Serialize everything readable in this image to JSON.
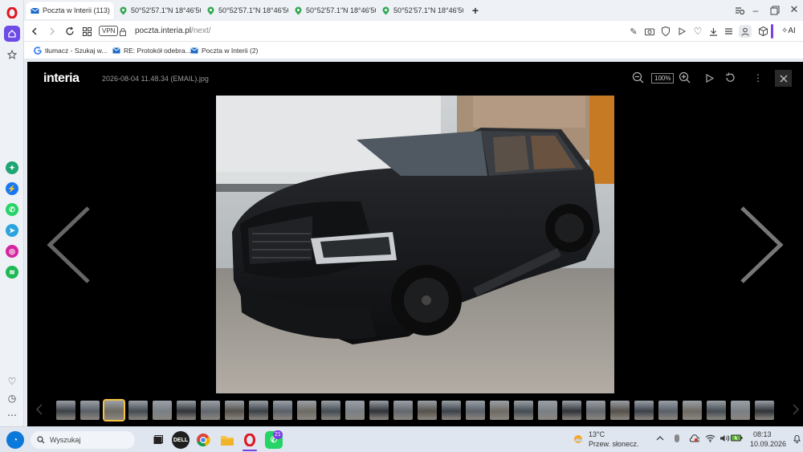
{
  "browser": {
    "tabs": [
      {
        "title": "Poczta w Interii (113)",
        "active": true,
        "icon": "mail-icon"
      },
      {
        "title": "50°52'57.1\"N 18°46'56.7\"E",
        "active": false,
        "icon": "maps-pin-icon"
      },
      {
        "title": "50°52'57.1\"N 18°46'56.7\"E",
        "active": false,
        "icon": "maps-pin-icon"
      },
      {
        "title": "50°52'57.1\"N 18°46'56.7\"E",
        "active": false,
        "icon": "maps-pin-icon"
      },
      {
        "title": "50°52'57.1\"N 18°46'56.7\"E",
        "active": false,
        "icon": "maps-pin-icon"
      }
    ],
    "new_tab_label": "+",
    "vpn_label": "VPN",
    "url_domain": "poczta.interia.pl",
    "url_path": "/next/",
    "ai_label": "AI",
    "bookmarks": [
      {
        "label": "tłumacz - Szukaj w...",
        "icon": "google-icon"
      },
      {
        "label": "RE: Protokół odebra...",
        "icon": "mail-icon"
      },
      {
        "label": "Poczta w Interii (2)",
        "icon": "mail-icon"
      }
    ]
  },
  "viewer": {
    "logo": "interia",
    "filename": "2026-08-04 11.48.34 (EMAIL).jpg",
    "zoom": "100%",
    "thumbnail_count": 30,
    "selected_thumbnail": 2
  },
  "taskbar": {
    "search_text": "Wyszukaj",
    "whatsapp_badge": "21",
    "weather_temp": "13°C",
    "weather_desc": "Przew. słonecz.",
    "time": "08:13",
    "date": "10.09.2026"
  },
  "colors": {
    "accent": "#7b3fe4",
    "opera_red": "#e1141f",
    "viewer_bg": "#000000"
  }
}
